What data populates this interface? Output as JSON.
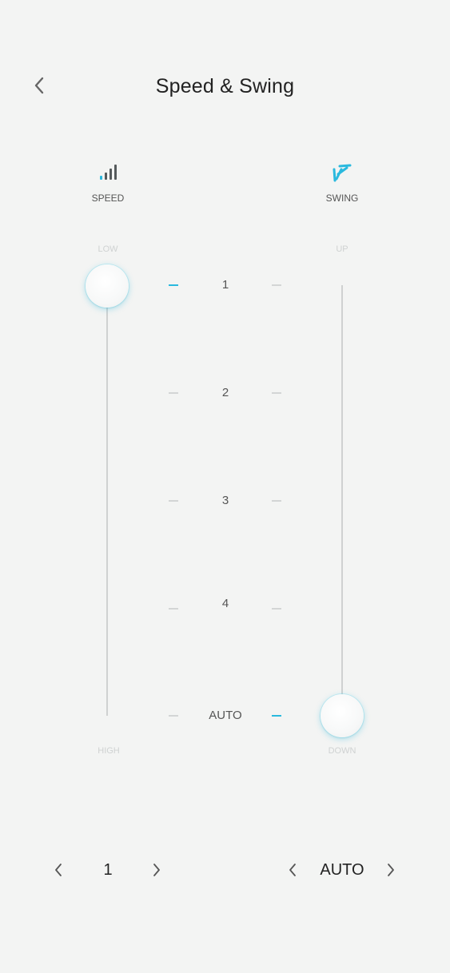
{
  "header": {
    "title": "Speed & Swing",
    "back_icon": "chevron-left-icon"
  },
  "speed": {
    "label": "SPEED",
    "icon": "signal-bars-icon",
    "top_label": "LOW",
    "bottom_label": "HIGH",
    "value": "1"
  },
  "swing": {
    "label": "SWING",
    "icon": "swing-fan-icon",
    "top_label": "UP",
    "bottom_label": "DOWN",
    "value": "AUTO"
  },
  "levels": [
    "1",
    "2",
    "3",
    "4",
    "AUTO"
  ],
  "colors": {
    "accent": "#2ab9de",
    "background": "#f3f4f3",
    "icon_dark": "#555a5c"
  }
}
